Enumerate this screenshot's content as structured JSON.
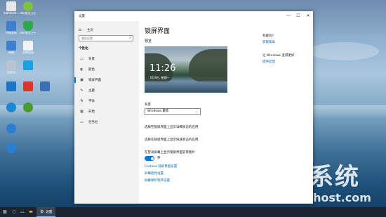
{
  "desktop": {
    "icons": [
      {
        "label": "Administr...",
        "color": "#e8e8e8"
      },
      {
        "label": "360安全卫士",
        "color": "#7cc242"
      },
      {
        "label": "控制面板",
        "color": "#3d7fd1"
      },
      {
        "label": "360安全卫士",
        "color": "#2ea84c"
      },
      {
        "label": "网络",
        "color": "#3d7fd1"
      },
      {
        "label": "宽带连接",
        "color": "#f2f2f2"
      },
      {
        "label": "回收站",
        "color": "#b9c4ce"
      },
      {
        "label": "",
        "color": "#1ca0e3"
      },
      {
        "label": "",
        "color": "#1e76c8"
      },
      {
        "label": "",
        "color": "#d8362f"
      },
      {
        "label": "",
        "color": "#3b6fb6"
      },
      {
        "label": "",
        "color": "#1a88d6"
      },
      {
        "label": "",
        "color": "#4a9a2c"
      },
      {
        "label": "",
        "color": "#2a7fd4"
      },
      {
        "label": "",
        "color": "#2a7fd4"
      }
    ]
  },
  "watermark": {
    "cn_text": "地系统",
    "en_text": "DadiGhost.com"
  },
  "window": {
    "title": "设置",
    "controls": {
      "minimize": "—",
      "maximize": "☐",
      "close": "✕"
    }
  },
  "sidebar": {
    "home": "主页",
    "search_placeholder": "查找设置",
    "section": "个性化",
    "items": [
      {
        "label": "背景",
        "icon": "▭"
      },
      {
        "label": "颜色",
        "icon": "◐"
      },
      {
        "label": "锁屏界面",
        "icon": "▣"
      },
      {
        "label": "主题",
        "icon": "✎"
      },
      {
        "label": "字体",
        "icon": "A"
      },
      {
        "label": "开始",
        "icon": "▦"
      },
      {
        "label": "任务栏",
        "icon": "▭"
      }
    ]
  },
  "content": {
    "page_title": "锁屏界面",
    "preview_label": "预览",
    "preview_time": "11:26",
    "preview_date": "6月8日, 星期一",
    "background_label": "背景",
    "background_value": "Windows 聚焦",
    "option1": "选择在锁屏界面上显示详细状态的应用",
    "option2": "选择在锁屏界面上显示快速状态的应用",
    "toggle_label": "在登录屏幕上显示锁屏界面背景图片",
    "toggle_state": "开",
    "link1": "Cortana 锁屏界面设置",
    "link2": "屏幕超时设置",
    "link3": "屏幕保护程序设置"
  },
  "right_column": {
    "q1": "有疑问?",
    "l1": "获取帮助",
    "q2": "让 Windows 变得更好",
    "l2": "提供反馈"
  },
  "taskbar": {
    "app_label": "设置"
  }
}
